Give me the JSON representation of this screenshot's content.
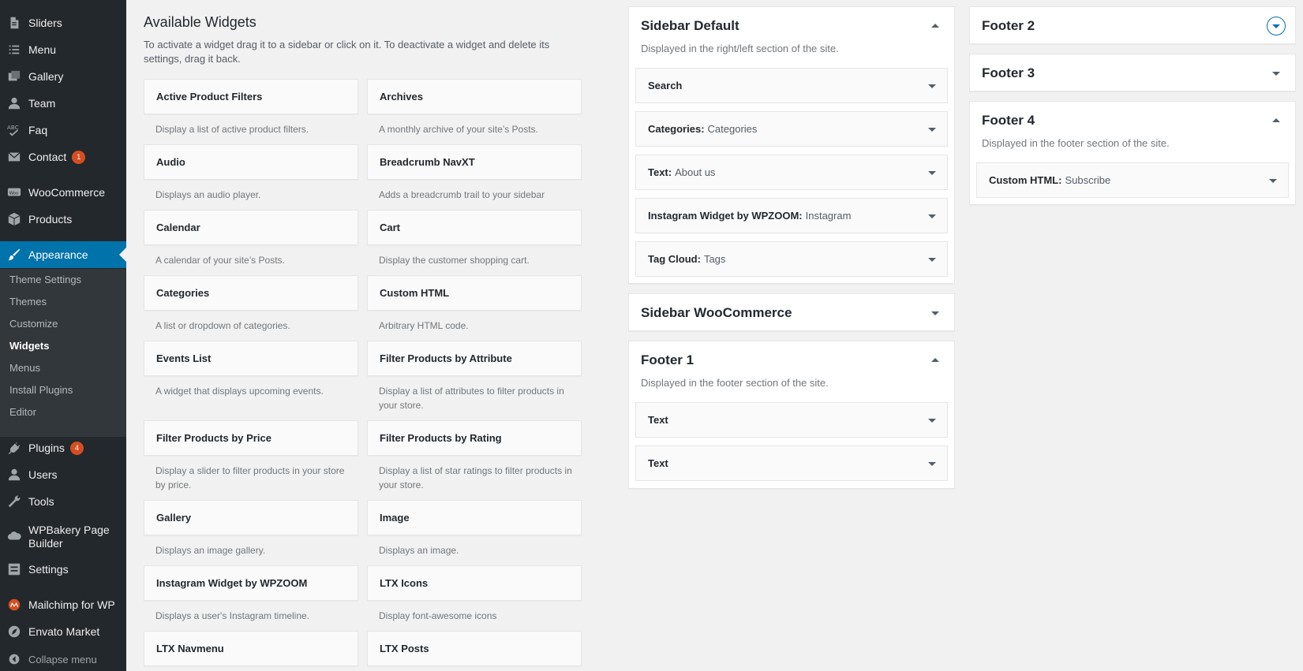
{
  "admin_menu": {
    "items": [
      {
        "label": "Sliders",
        "icon": "document-icon"
      },
      {
        "label": "Menu",
        "icon": "list-icon"
      },
      {
        "label": "Gallery",
        "icon": "images-icon"
      },
      {
        "label": "Team",
        "icon": "user-icon"
      },
      {
        "label": "Faq",
        "icon": "spellcheck-icon"
      },
      {
        "label": "Contact",
        "icon": "mail-icon",
        "badge": "1"
      },
      {
        "label": "WooCommerce",
        "icon": "woocommerce-icon"
      },
      {
        "label": "Products",
        "icon": "box-icon"
      },
      {
        "label": "Appearance",
        "icon": "brush-icon"
      },
      {
        "label": "Plugins",
        "icon": "plug-icon",
        "badge": "4"
      },
      {
        "label": "Users",
        "icon": "users-icon"
      },
      {
        "label": "Tools",
        "icon": "wrench-icon"
      },
      {
        "label": "WPBakery Page",
        "label2": "Builder",
        "icon": "cloud-icon"
      },
      {
        "label": "Settings",
        "icon": "settings-icon"
      },
      {
        "label": "Mailchimp for WP",
        "icon": "mailchimp-icon"
      },
      {
        "label": "Envato Market",
        "icon": "leaf-icon"
      }
    ],
    "submenu": [
      "Theme Settings",
      "Themes",
      "Customize",
      "Widgets",
      "Menus",
      "Install Plugins",
      "Editor"
    ],
    "collapse_label": "Collapse menu"
  },
  "available": {
    "title": "Available Widgets",
    "description": "To activate a widget drag it to a sidebar or click on it. To deactivate a widget and delete its settings, drag it back.",
    "widgets": [
      {
        "name": "Active Product Filters",
        "desc": "Display a list of active product filters."
      },
      {
        "name": "Archives",
        "desc": "A monthly archive of your site’s Posts."
      },
      {
        "name": "Audio",
        "desc": "Displays an audio player."
      },
      {
        "name": "Breadcrumb NavXT",
        "desc": "Adds a breadcrumb trail to your sidebar"
      },
      {
        "name": "Calendar",
        "desc": "A calendar of your site’s Posts."
      },
      {
        "name": "Cart",
        "desc": "Display the customer shopping cart."
      },
      {
        "name": "Categories",
        "desc": "A list or dropdown of categories."
      },
      {
        "name": "Custom HTML",
        "desc": "Arbitrary HTML code."
      },
      {
        "name": "Events List",
        "desc": "A widget that displays upcoming events."
      },
      {
        "name": "Filter Products by Attribute",
        "desc": "Display a list of attributes to filter products in your store."
      },
      {
        "name": "Filter Products by Price",
        "desc": "Display a slider to filter products in your store by price."
      },
      {
        "name": "Filter Products by Rating",
        "desc": "Display a list of star ratings to filter products in your store."
      },
      {
        "name": "Gallery",
        "desc": "Displays an image gallery."
      },
      {
        "name": "Image",
        "desc": "Displays an image."
      },
      {
        "name": "Instagram Widget by WPZOOM",
        "desc": "Displays a user's Instagram timeline."
      },
      {
        "name": "LTX Icons",
        "desc": "Display font-awesome icons"
      },
      {
        "name": "LTX Navmenu",
        "desc": ""
      },
      {
        "name": "LTX Posts",
        "desc": ""
      }
    ]
  },
  "sidebars": {
    "sidebar_default": {
      "title": "Sidebar Default",
      "description": "Displayed in the right/left section of the site.",
      "widgets": [
        {
          "type": "Search",
          "title": ""
        },
        {
          "type": "Categories",
          "title": "Categories"
        },
        {
          "type": "Text",
          "title": "About us"
        },
        {
          "type": "Instagram Widget by WPZOOM",
          "title": "Instagram"
        },
        {
          "type": "Tag Cloud",
          "title": "Tags"
        }
      ]
    },
    "sidebar_woocommerce": {
      "title": "Sidebar WooCommerce"
    },
    "footer1": {
      "title": "Footer 1",
      "description": "Displayed in the footer section of the site.",
      "widgets": [
        {
          "type": "Text",
          "title": ""
        },
        {
          "type": "Text",
          "title": ""
        }
      ]
    },
    "footer2": {
      "title": "Footer 2"
    },
    "footer3": {
      "title": "Footer 3"
    },
    "footer4": {
      "title": "Footer 4",
      "description": "Displayed in the footer section of the site.",
      "widgets": [
        {
          "type": "Custom HTML",
          "title": "Subscribe"
        }
      ]
    }
  }
}
